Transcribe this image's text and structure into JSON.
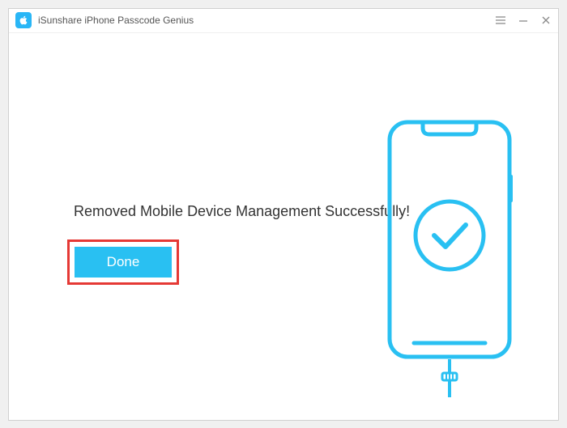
{
  "titlebar": {
    "app_title": "iSunshare iPhone Passcode Genius"
  },
  "main": {
    "message": "Removed Mobile Device Management Successfully!",
    "done_label": "Done"
  },
  "colors": {
    "accent": "#29c0f2",
    "highlight_border": "#e53935"
  },
  "icons": {
    "logo": "apple-icon",
    "menu": "menu-icon",
    "minimize": "minimize-icon",
    "close": "close-icon",
    "phone": "phone-success-icon",
    "check": "checkmark-icon"
  }
}
